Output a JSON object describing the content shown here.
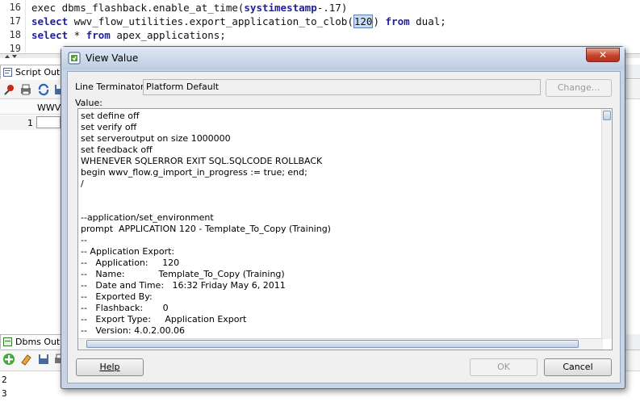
{
  "editor": {
    "lines": [
      {
        "num": "16",
        "text": [
          "exec dbms_flashback.enable_at_time(",
          "systimestamp",
          "-.17)"
        ]
      },
      {
        "num": "17",
        "text": [
          "select",
          " wwv_flow_utilities.export_application_to_clob(",
          "120",
          ") ",
          "from",
          " dual;"
        ]
      },
      {
        "num": "18",
        "text": [
          "select",
          " * ",
          "from",
          " apex_applications;"
        ]
      },
      {
        "num": "19",
        "text": [
          ""
        ]
      }
    ]
  },
  "script_output": {
    "tab_label": "Script Outpu",
    "column_header": "WWV",
    "row_num": "1"
  },
  "dbms_output": {
    "tab_label": "Dbms Outpu",
    "lines": [
      "2",
      "3"
    ]
  },
  "dialog": {
    "title": "View Value",
    "line_terminator_label": "Line Terminator:",
    "line_terminator_value": "Platform Default",
    "change_button": "Change...",
    "value_label": "Value:",
    "value_lines": [
      "set define off",
      "set verify off",
      "set serveroutput on size 1000000",
      "set feedback off",
      "WHENEVER SQLERROR EXIT SQL.SQLCODE ROLLBACK",
      "begin wwv_flow.g_import_in_progress := true; end;",
      "/",
      "",
      "",
      "--application/set_environment",
      "prompt  APPLICATION 120 - Template_To_Copy (Training)",
      "--",
      "-- Application Export:",
      "--   Application:     120",
      "--   Name:            Template_To_Copy (Training)",
      "--   Date and Time:   16:32 Friday May 6, 2011",
      "--   Exported By:",
      "--   Flashback:       0",
      "--   Export Type:     Application Export",
      "--   Version: 4.0.2.00.06"
    ],
    "help_button": "Help",
    "ok_button": "OK",
    "cancel_button": "Cancel",
    "close_glyph": "✕"
  },
  "colors": {
    "keyword": "#1f1fa0",
    "dialog_frame": "#c6d4e6",
    "close_red": "#c7422b"
  }
}
